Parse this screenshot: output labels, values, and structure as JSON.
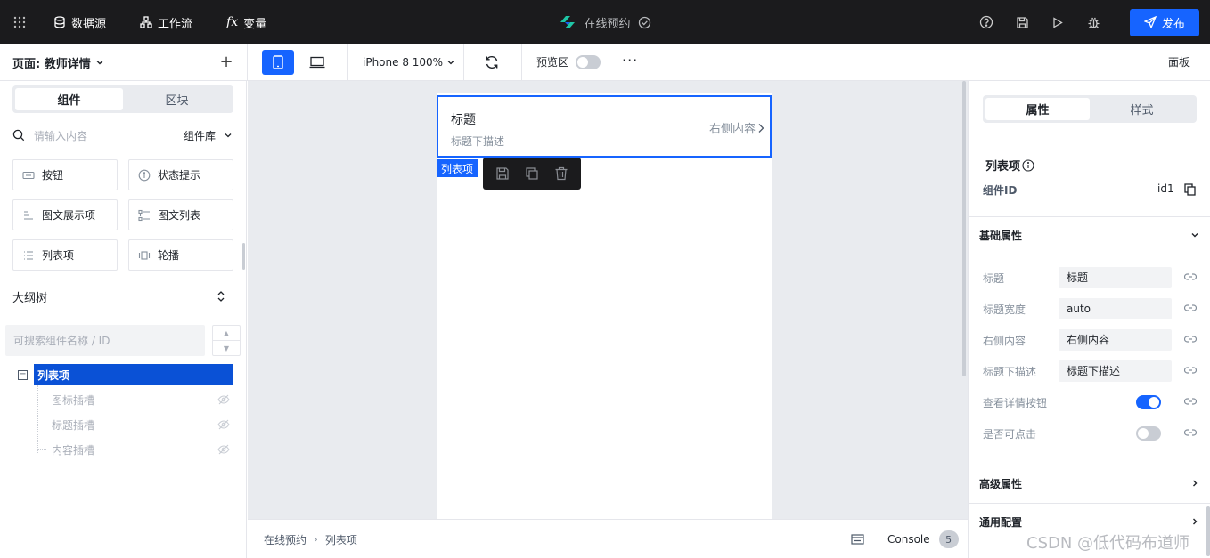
{
  "topbar": {
    "datasource": "数据源",
    "workflow": "工作流",
    "variable": "变量",
    "app_title": "在线预约",
    "publish": "发布"
  },
  "subbar": {
    "page_label": "页面: 教师详情",
    "device": "iPhone 8 100%",
    "preview": "预览区",
    "panel": "面板"
  },
  "left": {
    "tabs": [
      "组件",
      "区块"
    ],
    "search_placeholder": "请输入内容",
    "library": "组件库",
    "components": [
      "按钮",
      "状态提示",
      "图文展示项",
      "图文列表",
      "列表项",
      "轮播"
    ],
    "outline_title": "大纲树",
    "tree_search_placeholder": "可搜索组件名称 / ID",
    "tree_root": "列表项",
    "tree_children": [
      "图标插槽",
      "标题插槽",
      "内容插槽"
    ]
  },
  "canvas": {
    "item_title": "标题",
    "item_desc": "标题下描述",
    "item_right": "右侧内容",
    "selection_tag": "列表项",
    "breadcrumb": [
      "在线预约",
      "列表项"
    ],
    "console": "Console",
    "console_count": "5"
  },
  "right": {
    "tabs": [
      "属性",
      "样式"
    ],
    "component_name": "列表项",
    "id_label": "组件ID",
    "id_value": "id1",
    "basic_section": "基础属性",
    "props": {
      "title_label": "标题",
      "title_value": "标题",
      "width_label": "标题宽度",
      "width_value": "auto",
      "right_label": "右侧内容",
      "right_value": "右侧内容",
      "desc_label": "标题下描述",
      "desc_value": "标题下描述",
      "detail_btn_label": "查看详情按钮",
      "detail_btn_on": true,
      "clickable_label": "是否可点击",
      "clickable_on": false
    },
    "advanced_section": "高级属性",
    "common_section": "通用配置"
  },
  "watermark": "CSDN @低代码布道师",
  "colors": {
    "accent": "#1664ff",
    "topbar": "#1b1b1d",
    "canvas": "#e9ebef"
  }
}
